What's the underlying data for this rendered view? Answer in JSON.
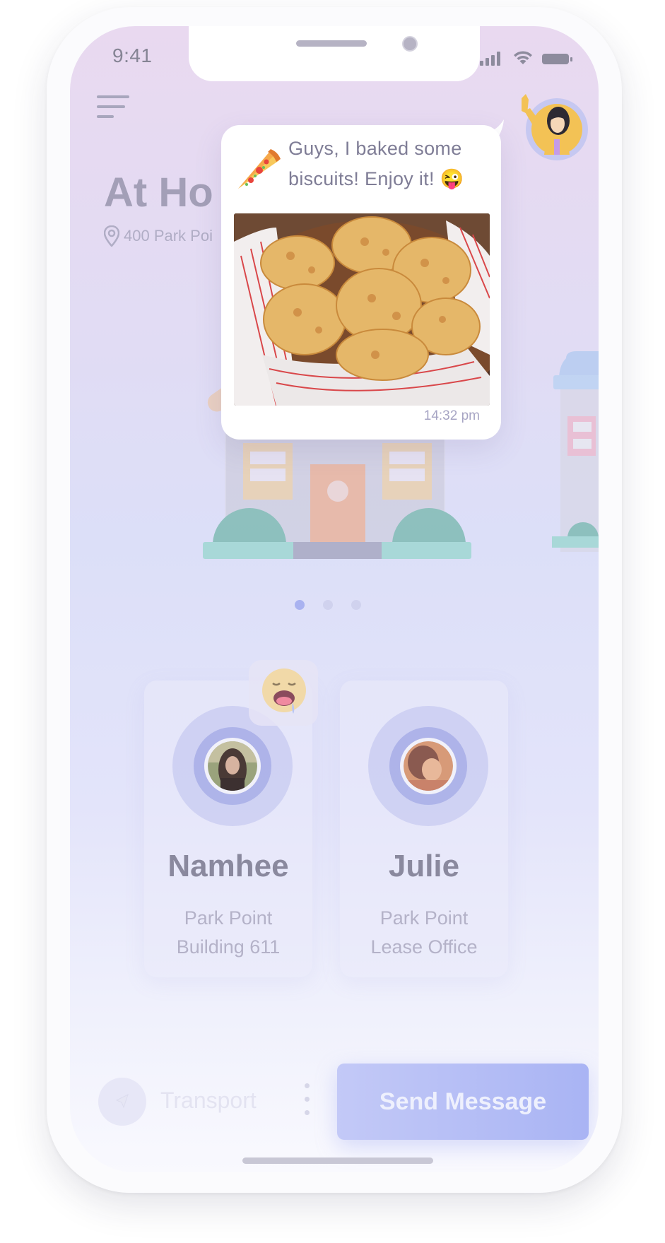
{
  "status_bar": {
    "time": "9:41"
  },
  "header": {
    "title": "At Ho",
    "address": "400 Park Poi"
  },
  "chat_bubble": {
    "message": "Guys, I baked some biscuits! Enjoy it! 😜",
    "timestamp": "14:32 pm",
    "image_icon": "biscuits-photo"
  },
  "carousel": {
    "page_count": 3,
    "active_index": 0
  },
  "contacts": [
    {
      "name": "Namhee",
      "location": "Park Point Building 611"
    },
    {
      "name": "Julie",
      "location": "Park Point Lease Office"
    }
  ],
  "reaction": {
    "icon": "drooling-face-emoji"
  },
  "bottom_bar": {
    "transport_label": "Transport",
    "send_label": "Send Message"
  },
  "colors": {
    "accent": "#a9b4f4",
    "title": "#8e8ca4",
    "bubble_text": "#7f7d96"
  }
}
